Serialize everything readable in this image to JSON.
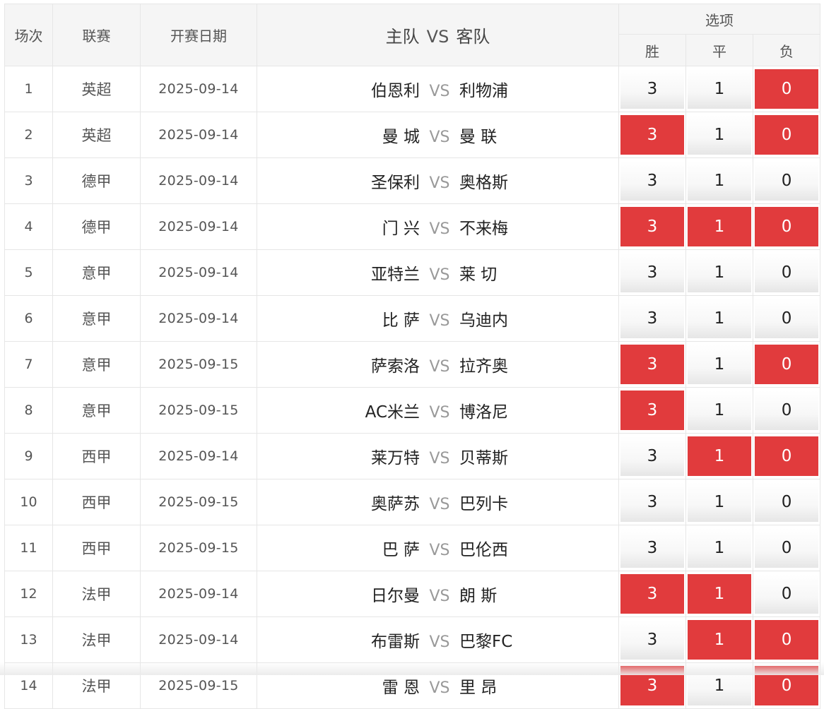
{
  "header": {
    "index": "场次",
    "league": "联赛",
    "date": "开赛日期",
    "home": "主队",
    "vs": "VS",
    "away": "客队",
    "options": "选项",
    "win": "胜",
    "draw": "平",
    "lose": "负"
  },
  "colors": {
    "selected": "#e13b3d",
    "header_bg": "#f5f5f5"
  },
  "rows": [
    {
      "idx": "1",
      "league": "英超",
      "date": "2025-09-14",
      "home": "伯恩利",
      "vs": "VS",
      "away": "利物浦",
      "win": "3",
      "draw": "1",
      "lose": "0",
      "sel": [
        false,
        false,
        true
      ]
    },
    {
      "idx": "2",
      "league": "英超",
      "date": "2025-09-14",
      "home": "曼 城",
      "vs": "VS",
      "away": "曼 联",
      "win": "3",
      "draw": "1",
      "lose": "0",
      "sel": [
        true,
        false,
        true
      ]
    },
    {
      "idx": "3",
      "league": "德甲",
      "date": "2025-09-14",
      "home": "圣保利",
      "vs": "VS",
      "away": "奥格斯",
      "win": "3",
      "draw": "1",
      "lose": "0",
      "sel": [
        false,
        false,
        false
      ]
    },
    {
      "idx": "4",
      "league": "德甲",
      "date": "2025-09-14",
      "home": "门 兴",
      "vs": "VS",
      "away": "不来梅",
      "win": "3",
      "draw": "1",
      "lose": "0",
      "sel": [
        true,
        true,
        true
      ]
    },
    {
      "idx": "5",
      "league": "意甲",
      "date": "2025-09-14",
      "home": "亚特兰",
      "vs": "VS",
      "away": "莱 切",
      "win": "3",
      "draw": "1",
      "lose": "0",
      "sel": [
        false,
        false,
        false
      ]
    },
    {
      "idx": "6",
      "league": "意甲",
      "date": "2025-09-14",
      "home": "比 萨",
      "vs": "VS",
      "away": "乌迪内",
      "win": "3",
      "draw": "1",
      "lose": "0",
      "sel": [
        false,
        false,
        false
      ]
    },
    {
      "idx": "7",
      "league": "意甲",
      "date": "2025-09-15",
      "home": "萨索洛",
      "vs": "VS",
      "away": "拉齐奥",
      "win": "3",
      "draw": "1",
      "lose": "0",
      "sel": [
        true,
        false,
        true
      ]
    },
    {
      "idx": "8",
      "league": "意甲",
      "date": "2025-09-15",
      "home": "AC米兰",
      "vs": "VS",
      "away": "博洛尼",
      "win": "3",
      "draw": "1",
      "lose": "0",
      "sel": [
        true,
        false,
        false
      ]
    },
    {
      "idx": "9",
      "league": "西甲",
      "date": "2025-09-14",
      "home": "莱万特",
      "vs": "VS",
      "away": "贝蒂斯",
      "win": "3",
      "draw": "1",
      "lose": "0",
      "sel": [
        false,
        true,
        true
      ]
    },
    {
      "idx": "10",
      "league": "西甲",
      "date": "2025-09-15",
      "home": "奥萨苏",
      "vs": "VS",
      "away": "巴列卡",
      "win": "3",
      "draw": "1",
      "lose": "0",
      "sel": [
        false,
        false,
        false
      ]
    },
    {
      "idx": "11",
      "league": "西甲",
      "date": "2025-09-15",
      "home": "巴 萨",
      "vs": "VS",
      "away": "巴伦西",
      "win": "3",
      "draw": "1",
      "lose": "0",
      "sel": [
        false,
        false,
        false
      ]
    },
    {
      "idx": "12",
      "league": "法甲",
      "date": "2025-09-14",
      "home": "日尔曼",
      "vs": "VS",
      "away": "朗 斯",
      "win": "3",
      "draw": "1",
      "lose": "0",
      "sel": [
        true,
        true,
        false
      ]
    },
    {
      "idx": "13",
      "league": "法甲",
      "date": "2025-09-14",
      "home": "布雷斯",
      "vs": "VS",
      "away": "巴黎FC",
      "win": "3",
      "draw": "1",
      "lose": "0",
      "sel": [
        false,
        true,
        true
      ]
    },
    {
      "idx": "14",
      "league": "法甲",
      "date": "2025-09-15",
      "home": "雷 恩",
      "vs": "VS",
      "away": "里 昂",
      "win": "3",
      "draw": "1",
      "lose": "0",
      "sel": [
        true,
        false,
        true
      ]
    }
  ]
}
